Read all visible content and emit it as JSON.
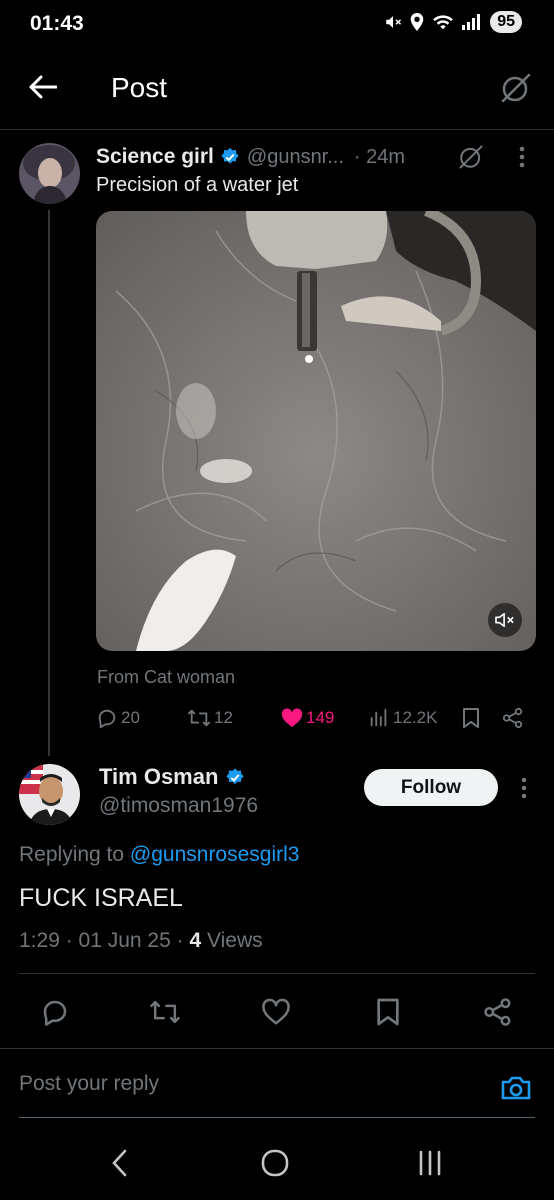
{
  "status_bar": {
    "time": "01:43",
    "battery": "95"
  },
  "header": {
    "title": "Post"
  },
  "post": {
    "author_name": "Science girl",
    "handle": "@gunsnr...",
    "time": "· 24m",
    "text": "Precision of a water jet",
    "from": "From Cat woman",
    "stats": {
      "replies": "20",
      "reposts": "12",
      "likes": "149",
      "views": "12.2K"
    }
  },
  "reply": {
    "author_name": "Tim Osman",
    "handle": "@timosman1976",
    "follow_label": "Follow",
    "replying_prefix": "Replying to",
    "replying_to": "@gunsnrosesgirl3",
    "text": "FUCK ISRAEL",
    "date": "1:29 · 01 Jun 25 ·",
    "views_count": "4",
    "views_label": "Views"
  },
  "composer": {
    "placeholder": "Post your reply"
  },
  "colors": {
    "accent": "#1d9bf0",
    "like": "#f91880",
    "muted": "#71767b"
  },
  "icons": [
    "back-arrow-icon",
    "grok-icon",
    "verified-icon",
    "more-icon",
    "mute-icon",
    "reply-icon",
    "repost-icon",
    "heart-icon",
    "views-icon",
    "bookmark-icon",
    "share-icon",
    "camera-icon",
    "nav-back-icon",
    "nav-home-icon",
    "nav-recents-icon"
  ]
}
